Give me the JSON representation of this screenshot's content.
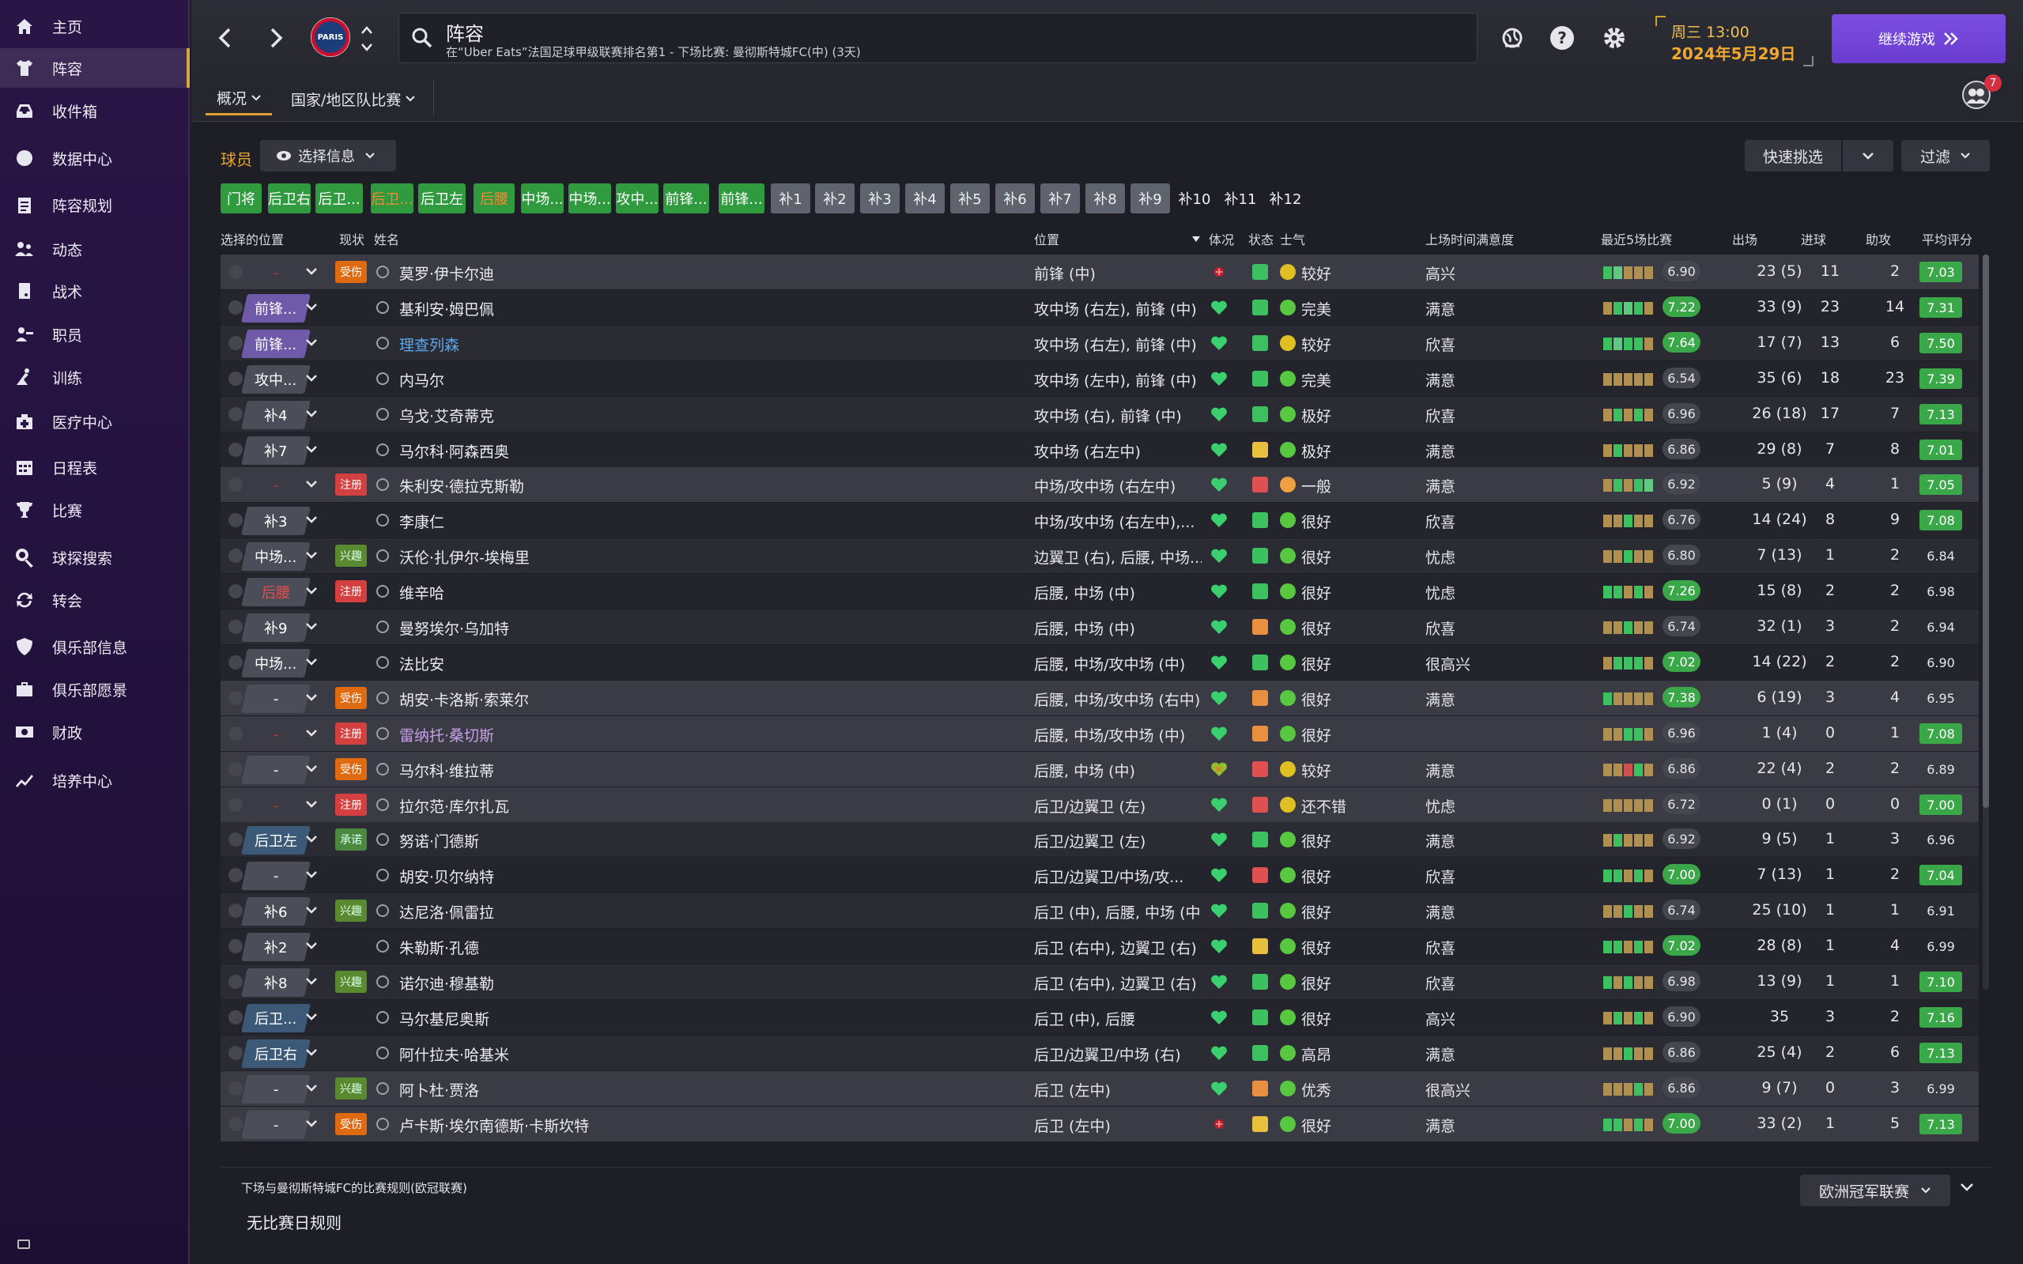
{
  "sidebar": {
    "items": [
      {
        "label": "主页",
        "icon": "home-icon"
      },
      {
        "label": "阵容",
        "icon": "jersey-icon",
        "active": true
      },
      {
        "label": "收件箱",
        "icon": "inbox-icon"
      },
      {
        "label": "数据中心",
        "icon": "data-icon"
      },
      {
        "label": "阵容规划",
        "icon": "clipboard-icon"
      },
      {
        "label": "动态",
        "icon": "people-icon"
      },
      {
        "label": "战术",
        "icon": "tactics-icon"
      },
      {
        "label": "职员",
        "icon": "staff-icon"
      },
      {
        "label": "训练",
        "icon": "training-icon"
      },
      {
        "label": "医疗中心",
        "icon": "medical-icon"
      },
      {
        "label": "日程表",
        "icon": "calendar-icon"
      },
      {
        "label": "比赛",
        "icon": "trophy-icon"
      },
      {
        "label": "球探搜索",
        "icon": "search-icon"
      },
      {
        "label": "转会",
        "icon": "transfer-icon"
      },
      {
        "label": "俱乐部信息",
        "icon": "shield-icon"
      },
      {
        "label": "俱乐部愿景",
        "icon": "briefcase-icon"
      },
      {
        "label": "财政",
        "icon": "money-icon"
      },
      {
        "label": "培养中心",
        "icon": "growth-icon"
      }
    ]
  },
  "header": {
    "crest_text": "PARIS",
    "title": "阵容",
    "subtitle": "在“Uber Eats”法国足球甲级联赛排名第1 - 下场比赛: 曼彻斯特城FC(中) (3天)",
    "date_time": "周三 13:00",
    "date_day": "2024年5月29日",
    "continue_label": "继续游戏",
    "notif_count": "7"
  },
  "tabs": {
    "overview": "概况",
    "national": "国家/地区队比赛"
  },
  "toolbar": {
    "players_label": "球员",
    "select_info": "选择信息",
    "quick_pick": "快速挑选",
    "filter": "过滤"
  },
  "chips": [
    {
      "label": "门将",
      "style": "g"
    },
    {
      "label": "后卫右",
      "style": "g"
    },
    {
      "label": "后卫...",
      "style": "g"
    },
    {
      "label": "后卫...",
      "style": "go"
    },
    {
      "label": "后卫左",
      "style": "g"
    },
    {
      "label": "后腰",
      "style": "go"
    },
    {
      "label": "中场...",
      "style": "g"
    },
    {
      "label": "中场...",
      "style": "g"
    },
    {
      "label": "攻中...",
      "style": "g"
    },
    {
      "label": "前锋...",
      "style": "g"
    },
    {
      "label": "前锋...",
      "style": "g"
    },
    {
      "label": "补1",
      "style": "s"
    },
    {
      "label": "补2",
      "style": "s"
    },
    {
      "label": "补3",
      "style": "s"
    },
    {
      "label": "补4",
      "style": "s"
    },
    {
      "label": "补5",
      "style": "s"
    },
    {
      "label": "补6",
      "style": "s"
    },
    {
      "label": "补7",
      "style": "s"
    },
    {
      "label": "补8",
      "style": "s"
    },
    {
      "label": "补9",
      "style": "s"
    },
    {
      "label": "补10",
      "style": "d"
    },
    {
      "label": "补11",
      "style": "d"
    },
    {
      "label": "补12",
      "style": "d"
    }
  ],
  "columns": {
    "selected_position": "选择的位置",
    "status_now": "现状",
    "name": "姓名",
    "position": "位置",
    "condition": "体况",
    "state": "状态",
    "morale": "士气",
    "playtime": "上场时间满意度",
    "last5": "最近5场比赛",
    "apps": "出场",
    "goals": "进球",
    "assists": "助攻",
    "avg_rating": "平均评分"
  },
  "players": [
    {
      "sel": "-",
      "selstyle": "none",
      "badge": "受伤",
      "badgetype": "b-injured",
      "name": "莫罗·伊卡尔迪",
      "nameclass": "",
      "position": "前锋 (中)",
      "cond": "injured",
      "status": "st-green",
      "moodc": "mo-yellow",
      "morale": "较好",
      "play": "高兴",
      "form": "f1 f4 f2 f2 f2",
      "formv": "6.90",
      "formhi": false,
      "apps": "23 (5)",
      "goals": "11",
      "assists": "2",
      "rating": "7.03",
      "rgood": true,
      "hl": true
    },
    {
      "sel": "前锋...",
      "selstyle": "purple",
      "badge": "",
      "badgetype": "",
      "name": "基利安·姆巴佩",
      "nameclass": "",
      "position": "攻中场 (右左), 前锋 (中)",
      "cond": "heart",
      "status": "st-green",
      "moodc": "mo-green",
      "morale": "完美",
      "play": "满意",
      "form": "f2 f1 f4 f1 f2",
      "formv": "7.22",
      "formhi": true,
      "apps": "33 (9)",
      "goals": "23",
      "assists": "14",
      "rating": "7.31",
      "rgood": true
    },
    {
      "sel": "前锋...",
      "selstyle": "purple",
      "badge": "",
      "badgetype": "",
      "name": "理查列森",
      "nameclass": "link",
      "position": "攻中场 (右左), 前锋 (中)",
      "cond": "heart",
      "status": "st-green",
      "moodc": "mo-yellow",
      "morale": "较好",
      "play": "欣喜",
      "form": "f1 f4 f1 f1 f2",
      "formv": "7.64",
      "formhi": true,
      "apps": "17 (7)",
      "goals": "13",
      "assists": "6",
      "rating": "7.50",
      "rgood": true
    },
    {
      "sel": "攻中...",
      "selstyle": "grey",
      "badge": "",
      "badgetype": "",
      "name": "内马尔",
      "nameclass": "",
      "position": "攻中场 (左中), 前锋 (中)",
      "cond": "heart",
      "status": "st-green",
      "moodc": "mo-green",
      "morale": "完美",
      "play": "满意",
      "form": "f2 f2 f2 f2 f2",
      "formv": "6.54",
      "formhi": false,
      "apps": "35 (6)",
      "goals": "18",
      "assists": "23",
      "rating": "7.39",
      "rgood": true
    },
    {
      "sel": "补4",
      "selstyle": "grey",
      "badge": "",
      "badgetype": "",
      "name": "乌戈·艾奇蒂克",
      "nameclass": "",
      "position": "攻中场 (右), 前锋 (中)",
      "cond": "heart",
      "status": "st-green",
      "moodc": "mo-green",
      "morale": "极好",
      "play": "欣喜",
      "form": "f2 f1 f2 f1 f2",
      "formv": "6.96",
      "formhi": false,
      "apps": "26 (18)",
      "goals": "17",
      "assists": "7",
      "rating": "7.13",
      "rgood": true
    },
    {
      "sel": "补7",
      "selstyle": "grey",
      "badge": "",
      "badgetype": "",
      "name": "马尔科·阿森西奥",
      "nameclass": "",
      "position": "攻中场 (右左中)",
      "cond": "heart",
      "status": "st-yellow",
      "moodc": "mo-green",
      "morale": "极好",
      "play": "满意",
      "form": "f2 f1 f2 f2 f2",
      "formv": "6.86",
      "formhi": false,
      "apps": "29 (8)",
      "goals": "7",
      "assists": "8",
      "rating": "7.01",
      "rgood": true
    },
    {
      "sel": "-",
      "selstyle": "none",
      "badge": "注册",
      "badgetype": "b-reg",
      "name": "朱利安·德拉克斯勒",
      "nameclass": "",
      "position": "中场/攻中场 (右左中)",
      "cond": "heart",
      "status": "st-red",
      "moodc": "mo-orange",
      "morale": "一般",
      "play": "满意",
      "form": "f2 f1 f2 f1 f4",
      "formv": "6.92",
      "formhi": false,
      "apps": "5 (9)",
      "goals": "4",
      "assists": "1",
      "rating": "7.05",
      "rgood": true,
      "hl": true
    },
    {
      "sel": "补3",
      "selstyle": "grey",
      "badge": "",
      "badgetype": "",
      "name": "李康仁",
      "nameclass": "",
      "position": "中场/攻中场 (右左中),...",
      "cond": "heart",
      "status": "st-green",
      "moodc": "mo-green",
      "morale": "很好",
      "play": "欣喜",
      "form": "f2 f2 f1 f2 f2",
      "formv": "6.76",
      "formhi": false,
      "apps": "14 (24)",
      "goals": "8",
      "assists": "9",
      "rating": "7.08",
      "rgood": true
    },
    {
      "sel": "中场...",
      "selstyle": "grey",
      "badge": "兴趣",
      "badgetype": "b-interest",
      "name": "沃伦·扎伊尔-埃梅里",
      "nameclass": "",
      "position": "边翼卫 (右), 后腰, 中场...",
      "cond": "heart",
      "status": "st-green",
      "moodc": "mo-green",
      "morale": "很好",
      "play": "忧虑",
      "form": "f2 f2 f1 f2 f2",
      "formv": "6.80",
      "formhi": false,
      "apps": "7 (13)",
      "goals": "1",
      "assists": "2",
      "rating": "6.84",
      "rgood": false
    },
    {
      "sel": "后腰",
      "selstyle": "redpos",
      "badge": "注册",
      "badgetype": "b-reg",
      "name": "维辛哈",
      "nameclass": "",
      "position": "后腰, 中场 (中)",
      "cond": "heart",
      "status": "st-green",
      "moodc": "mo-green",
      "morale": "很好",
      "play": "忧虑",
      "form": "f1 f1 f2 f1 f2",
      "formv": "7.26",
      "formhi": true,
      "apps": "15 (8)",
      "goals": "2",
      "assists": "2",
      "rating": "6.98",
      "rgood": false
    },
    {
      "sel": "补9",
      "selstyle": "grey",
      "badge": "",
      "badgetype": "",
      "name": "曼努埃尔·乌加特",
      "nameclass": "",
      "position": "后腰, 中场 (中)",
      "cond": "heart",
      "status": "st-orange",
      "moodc": "mo-green",
      "morale": "很好",
      "play": "欣喜",
      "form": "f2 f2 f1 f2 f2",
      "formv": "6.74",
      "formhi": false,
      "apps": "32 (1)",
      "goals": "3",
      "assists": "2",
      "rating": "6.94",
      "rgood": false
    },
    {
      "sel": "中场...",
      "selstyle": "grey",
      "badge": "",
      "badgetype": "",
      "name": "法比安",
      "nameclass": "",
      "position": "后腰, 中场/攻中场 (中)",
      "cond": "heart",
      "status": "st-green",
      "moodc": "mo-green",
      "morale": "很好",
      "play": "很高兴",
      "form": "f2 f1 f1 f1 f2",
      "formv": "7.02",
      "formhi": true,
      "apps": "14 (22)",
      "goals": "2",
      "assists": "2",
      "rating": "6.90",
      "rgood": false
    },
    {
      "sel": "-",
      "selstyle": "grey",
      "badge": "受伤",
      "badgetype": "b-injured",
      "name": "胡安·卡洛斯·索莱尔",
      "nameclass": "",
      "position": "后腰, 中场/攻中场 (右中)",
      "cond": "heart",
      "status": "st-orange",
      "moodc": "mo-green",
      "morale": "很好",
      "play": "满意",
      "form": "f1 f2 f2 f2 f2",
      "formv": "7.38",
      "formhi": true,
      "apps": "6 (19)",
      "goals": "3",
      "assists": "4",
      "rating": "6.95",
      "rgood": false,
      "hl": true
    },
    {
      "sel": "-",
      "selstyle": "none",
      "badge": "注册",
      "badgetype": "b-reg",
      "name": "雷纳托·桑切斯",
      "nameclass": "purple",
      "position": "后腰, 中场/攻中场 (中)",
      "cond": "heart",
      "status": "st-orange",
      "moodc": "mo-green",
      "morale": "很好",
      "play": "",
      "form": "f2 f2 f1 f1 f2",
      "formv": "6.96",
      "formhi": false,
      "apps": "1 (4)",
      "goals": "0",
      "assists": "1",
      "rating": "7.08",
      "rgood": true,
      "hl": true
    },
    {
      "sel": "-",
      "selstyle": "grey",
      "badge": "受伤",
      "badgetype": "b-injured",
      "name": "马尔科·维拉蒂",
      "nameclass": "",
      "position": "后腰, 中场 (中)",
      "cond": "heartcross",
      "status": "st-red",
      "moodc": "mo-yellow",
      "morale": "较好",
      "play": "满意",
      "form": "f2 f2 f3 f1 f2",
      "formv": "6.86",
      "formhi": false,
      "apps": "22 (4)",
      "goals": "2",
      "assists": "2",
      "rating": "6.89",
      "rgood": false,
      "hl": true
    },
    {
      "sel": "-",
      "selstyle": "none",
      "badge": "注册",
      "badgetype": "b-reg",
      "name": "拉尔范·库尔扎瓦",
      "nameclass": "",
      "position": "后卫/边翼卫 (左)",
      "cond": "heart",
      "status": "st-red",
      "moodc": "mo-yellow",
      "morale": "还不错",
      "play": "忧虑",
      "form": "f2 f2 f2 f2 f2",
      "formv": "6.72",
      "formhi": false,
      "apps": "0 (1)",
      "goals": "0",
      "assists": "0",
      "rating": "7.00",
      "rgood": true,
      "hl": true
    },
    {
      "sel": "后卫左",
      "selstyle": "blue",
      "badge": "承诺",
      "badgetype": "b-promise",
      "name": "努诺·门德斯",
      "nameclass": "",
      "position": "后卫/边翼卫 (左)",
      "cond": "heart",
      "status": "st-green",
      "moodc": "mo-green",
      "morale": "很好",
      "play": "满意",
      "form": "f2 f1 f2 f2 f2",
      "formv": "6.92",
      "formhi": false,
      "apps": "9 (5)",
      "goals": "1",
      "assists": "3",
      "rating": "6.96",
      "rgood": false
    },
    {
      "sel": "-",
      "selstyle": "grey",
      "badge": "",
      "badgetype": "",
      "name": "胡安·贝尔纳特",
      "nameclass": "",
      "position": "后卫/边翼卫/中场/攻...",
      "cond": "heart",
      "status": "st-red",
      "moodc": "mo-green",
      "morale": "很好",
      "play": "欣喜",
      "form": "f1 f1 f2 f1 f2",
      "formv": "7.00",
      "formhi": true,
      "apps": "7 (13)",
      "goals": "1",
      "assists": "2",
      "rating": "7.04",
      "rgood": true
    },
    {
      "sel": "补6",
      "selstyle": "grey",
      "badge": "兴趣",
      "badgetype": "b-interest",
      "name": "达尼洛·佩雷拉",
      "nameclass": "",
      "position": "后卫 (中), 后腰, 中场 (中)",
      "cond": "heart",
      "status": "st-green",
      "moodc": "mo-green",
      "morale": "很好",
      "play": "满意",
      "form": "f2 f2 f1 f2 f2",
      "formv": "6.74",
      "formhi": false,
      "apps": "25 (10)",
      "goals": "1",
      "assists": "1",
      "rating": "6.91",
      "rgood": false
    },
    {
      "sel": "补2",
      "selstyle": "grey",
      "badge": "",
      "badgetype": "",
      "name": "朱勒斯·孔德",
      "nameclass": "",
      "position": "后卫 (右中), 边翼卫 (右)",
      "cond": "heart",
      "status": "st-yellow",
      "moodc": "mo-green",
      "morale": "很好",
      "play": "欣喜",
      "form": "f1 f1 f2 f1 f2",
      "formv": "7.02",
      "formhi": true,
      "apps": "28 (8)",
      "goals": "1",
      "assists": "4",
      "rating": "6.99",
      "rgood": false
    },
    {
      "sel": "补8",
      "selstyle": "grey",
      "badge": "兴趣",
      "badgetype": "b-interest",
      "name": "诺尔迪·穆基勒",
      "nameclass": "",
      "position": "后卫 (右中), 边翼卫 (右)",
      "cond": "heart",
      "status": "st-green",
      "moodc": "mo-green",
      "morale": "很好",
      "play": "欣喜",
      "form": "f1 f2 f1 f2 f2",
      "formv": "6.98",
      "formhi": false,
      "apps": "13 (9)",
      "goals": "1",
      "assists": "1",
      "rating": "7.10",
      "rgood": true
    },
    {
      "sel": "后卫...",
      "selstyle": "blue",
      "badge": "",
      "badgetype": "",
      "name": "马尔基尼奥斯",
      "nameclass": "",
      "position": "后卫 (中), 后腰",
      "cond": "heart",
      "status": "st-green",
      "moodc": "mo-green",
      "morale": "很好",
      "play": "高兴",
      "form": "f2 f1 f2 f1 f2",
      "formv": "6.90",
      "formhi": false,
      "apps": "35",
      "goals": "3",
      "assists": "2",
      "rating": "7.16",
      "rgood": true
    },
    {
      "sel": "后卫右",
      "selstyle": "blue",
      "badge": "",
      "badgetype": "",
      "name": "阿什拉夫·哈基米",
      "nameclass": "",
      "position": "后卫/边翼卫/中场 (右)",
      "cond": "heart",
      "status": "st-green",
      "moodc": "mo-green",
      "morale": "高昂",
      "play": "满意",
      "form": "f2 f2 f1 f2 f2",
      "formv": "6.86",
      "formhi": false,
      "apps": "25 (4)",
      "goals": "2",
      "assists": "6",
      "rating": "7.13",
      "rgood": true
    },
    {
      "sel": "-",
      "selstyle": "grey",
      "badge": "兴趣",
      "badgetype": "b-interest",
      "name": "阿卜杜·贾洛",
      "nameclass": "",
      "position": "后卫 (左中)",
      "cond": "heart",
      "status": "st-orange",
      "moodc": "mo-green",
      "morale": "优秀",
      "play": "很高兴",
      "form": "f2 f2 f2 f1 f2",
      "formv": "6.86",
      "formhi": false,
      "apps": "9 (7)",
      "goals": "0",
      "assists": "3",
      "rating": "6.99",
      "rgood": false,
      "hl": true
    },
    {
      "sel": "-",
      "selstyle": "grey",
      "badge": "受伤",
      "badgetype": "b-injured",
      "name": "卢卡斯·埃尔南德斯·卡斯坎特",
      "nameclass": "",
      "position": "后卫 (左中)",
      "cond": "injured",
      "status": "st-yellow",
      "moodc": "mo-green",
      "morale": "很好",
      "play": "满意",
      "form": "f1 f1 f2 f1 f2",
      "formv": "7.00",
      "formhi": true,
      "apps": "33 (2)",
      "goals": "1",
      "assists": "5",
      "rating": "7.13",
      "rgood": true,
      "hl": true
    }
  ],
  "footer": {
    "title": "下场与曼彻斯特城FC的比赛规则(欧冠联赛)",
    "rule": "无比赛日规则",
    "competition": "欧洲冠军联赛"
  }
}
